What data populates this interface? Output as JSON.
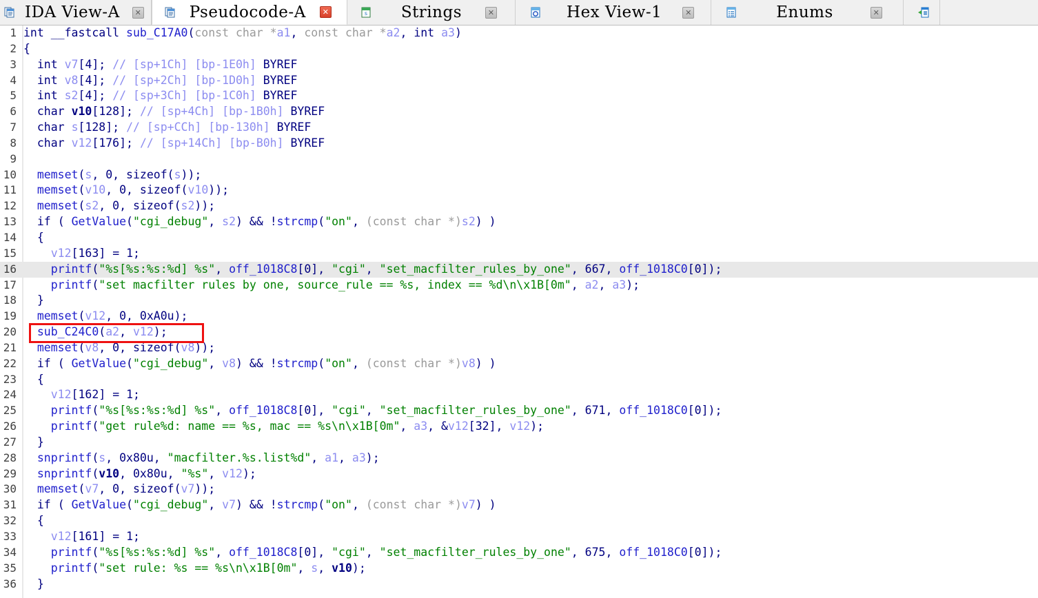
{
  "window": {
    "app": "IDA Pro",
    "view": "Pseudocode-A"
  },
  "tabs": [
    {
      "label": "IDA View-A",
      "icon": "document-blue-icon",
      "close": "close-icon",
      "active": false,
      "close_style": "grey"
    },
    {
      "label": "Pseudocode-A",
      "icon": "document-blue-icon",
      "close": "close-icon",
      "active": true,
      "close_style": "red"
    },
    {
      "label": "Strings",
      "icon": "strings-icon",
      "close": "close-icon",
      "active": false,
      "close_style": "grey"
    },
    {
      "label": "Hex View-1",
      "icon": "hex-view-icon",
      "close": "close-icon",
      "active": false,
      "close_style": "grey"
    },
    {
      "label": "Enums",
      "icon": "enums-icon",
      "close": "close-icon",
      "active": false,
      "close_style": "grey"
    }
  ],
  "overflow_tab": {
    "icon": "imports-icon"
  },
  "colors": {
    "background": "#ffffff",
    "tabbar_bg": "#f0f0f0",
    "current_line_highlight": "#e8e8e8",
    "annotation_red": "#ee1111",
    "keyword": "#000080",
    "function": "#2020cc",
    "string": "#008000",
    "variable": "#8c8cf0",
    "comment": "#8c8cf0",
    "cast": "#9a9a9a",
    "line_number": "#404040"
  },
  "annotation": {
    "shape": "rectangle",
    "color": "#ee1111",
    "target_line": 20,
    "target_text": "sub_C24C0(a2, v12);"
  },
  "code": {
    "function_signature": "int __fastcall sub_C17A0(const char *a1, const char *a2, int a3)",
    "highlighted_line": 16,
    "first_line": 1,
    "last_line": 36,
    "lines": [
      {
        "n": "1",
        "text": "int __fastcall sub_C17A0(const char *a1, const char *a2, int a3)"
      },
      {
        "n": "2",
        "text": "{"
      },
      {
        "n": "3",
        "text": "  int v7[4]; // [sp+1Ch] [bp-1E0h] BYREF"
      },
      {
        "n": "4",
        "text": "  int v8[4]; // [sp+2Ch] [bp-1D0h] BYREF"
      },
      {
        "n": "5",
        "text": "  int s2[4]; // [sp+3Ch] [bp-1C0h] BYREF"
      },
      {
        "n": "6",
        "text": "  char v10[128]; // [sp+4Ch] [bp-1B0h] BYREF"
      },
      {
        "n": "7",
        "text": "  char s[128]; // [sp+CCh] [bp-130h] BYREF"
      },
      {
        "n": "8",
        "text": "  char v12[176]; // [sp+14Ch] [bp-B0h] BYREF"
      },
      {
        "n": "9",
        "text": ""
      },
      {
        "n": "10",
        "text": "  memset(s, 0, sizeof(s));"
      },
      {
        "n": "11",
        "text": "  memset(v10, 0, sizeof(v10));"
      },
      {
        "n": "12",
        "text": "  memset(s2, 0, sizeof(s2));"
      },
      {
        "n": "13",
        "text": "  if ( GetValue(\"cgi_debug\", s2) && !strcmp(\"on\", (const char *)s2) )"
      },
      {
        "n": "14",
        "text": "  {"
      },
      {
        "n": "15",
        "text": "    v12[163] = 1;"
      },
      {
        "n": "16",
        "text": "    printf(\"%s[%s:%s:%d] %s\", off_1018C8[0], \"cgi\", \"set_macfilter_rules_by_one\", 667, off_1018C0[0]);"
      },
      {
        "n": "17",
        "text": "    printf(\"set macfilter rules by one, source_rule == %s, index == %d\\n\\x1B[0m\", a2, a3);"
      },
      {
        "n": "18",
        "text": "  }"
      },
      {
        "n": "19",
        "text": "  memset(v12, 0, 0xA0u);"
      },
      {
        "n": "20",
        "text": "  sub_C24C0(a2, v12);"
      },
      {
        "n": "21",
        "text": "  memset(v8, 0, sizeof(v8));"
      },
      {
        "n": "22",
        "text": "  if ( GetValue(\"cgi_debug\", v8) && !strcmp(\"on\", (const char *)v8) )"
      },
      {
        "n": "23",
        "text": "  {"
      },
      {
        "n": "24",
        "text": "    v12[162] = 1;"
      },
      {
        "n": "25",
        "text": "    printf(\"%s[%s:%s:%d] %s\", off_1018C8[0], \"cgi\", \"set_macfilter_rules_by_one\", 671, off_1018C0[0]);"
      },
      {
        "n": "26",
        "text": "    printf(\"get rule%d: name == %s, mac == %s\\n\\x1B[0m\", a3, &v12[32], v12);"
      },
      {
        "n": "27",
        "text": "  }"
      },
      {
        "n": "28",
        "text": "  snprintf(s, 0x80u, \"macfilter.%s.list%d\", a1, a3);"
      },
      {
        "n": "29",
        "text": "  snprintf(v10, 0x80u, \"%s\", v12);"
      },
      {
        "n": "30",
        "text": "  memset(v7, 0, sizeof(v7));"
      },
      {
        "n": "31",
        "text": "  if ( GetValue(\"cgi_debug\", v7) && !strcmp(\"on\", (const char *)v7) )"
      },
      {
        "n": "32",
        "text": "  {"
      },
      {
        "n": "33",
        "text": "    v12[161] = 1;"
      },
      {
        "n": "34",
        "text": "    printf(\"%s[%s:%s:%d] %s\", off_1018C8[0], \"cgi\", \"set_macfilter_rules_by_one\", 675, off_1018C0[0]);"
      },
      {
        "n": "35",
        "text": "    printf(\"set rule: %s == %s\\n\\x1B[0m\", s, v10);"
      },
      {
        "n": "36",
        "text": "  }"
      }
    ]
  }
}
